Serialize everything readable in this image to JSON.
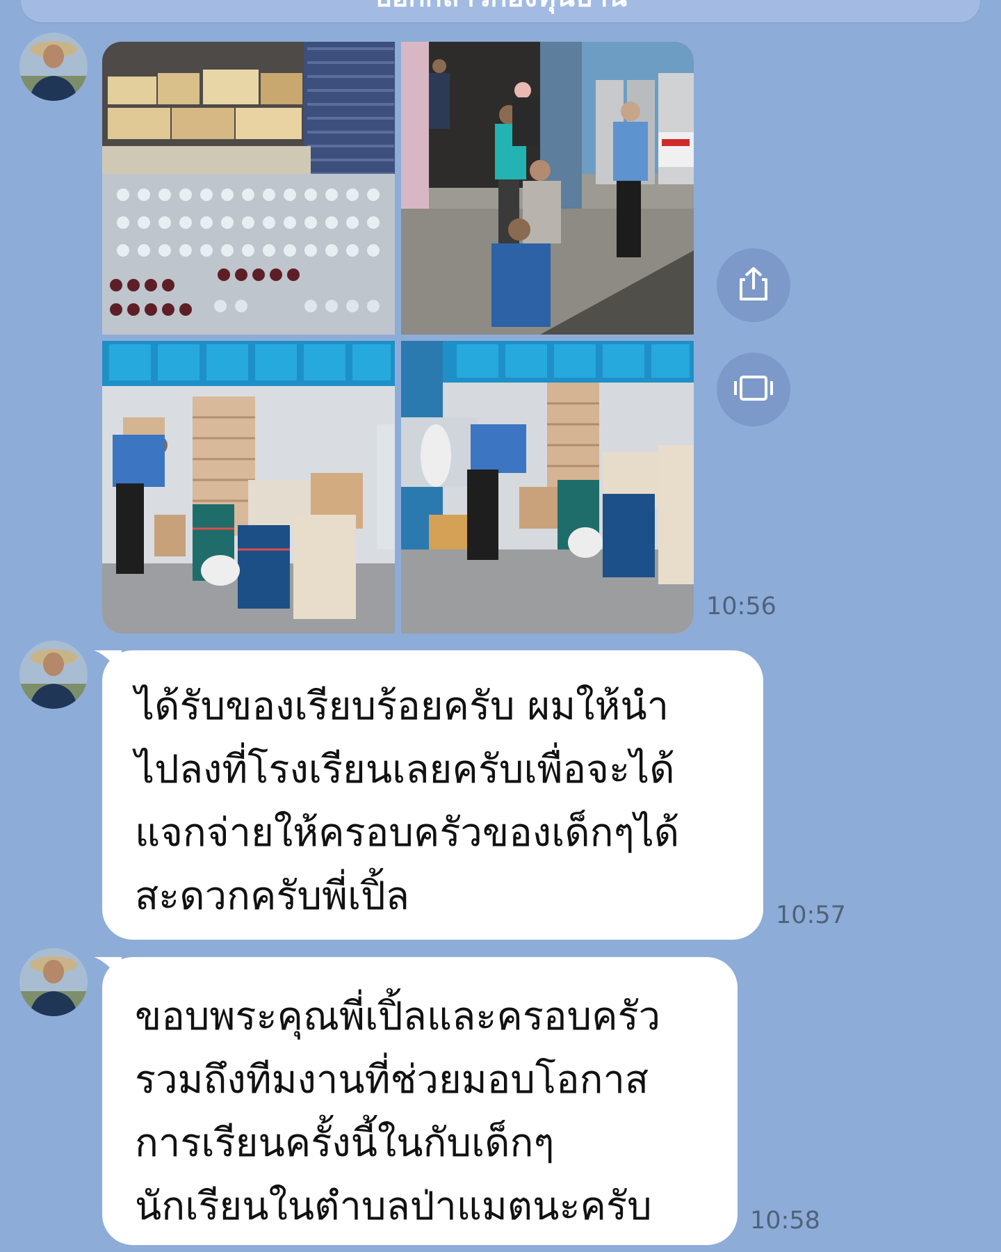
{
  "header": {
    "title": "บอกกล่าวกองทุนบ้าน"
  },
  "colors": {
    "chat_background": "#8eacd8",
    "bubble": "#ffffff",
    "header": "#a3bbe2",
    "action_button": "#7c99c9",
    "timestamp": "#4f6279"
  },
  "messages": [
    {
      "type": "photo-album",
      "photo_count": 4,
      "photos": [
        {
          "caption": "truck loaded with drinking water bottles and boxes"
        },
        {
          "caption": "men handing over bottled water at a building entrance"
        },
        {
          "caption": "donated supplies stacked against a wall, man writing"
        },
        {
          "caption": "donated supplies and woven bags against a wall"
        }
      ],
      "actions": [
        {
          "icon": "share-icon"
        },
        {
          "icon": "slideshow-icon"
        }
      ],
      "time": "10:56"
    },
    {
      "type": "text",
      "lines": [
        "ได้รับของเรียบร้อยครับ ผมให้นำ",
        "ไปลงที่โรงเรียนเลยครับเพื่อจะได้",
        "แจกจ่ายให้ครอบครัวของเด็กๆได้",
        "สะดวกครับพี่เปิ้ล"
      ],
      "time": "10:57"
    },
    {
      "type": "text",
      "lines": [
        "ขอบพระคุณพี่เปิ้ลและครอบครัว",
        "รวมถึงทีมงานที่ช่วยมอบโอกาส",
        "การเรียนครั้งนี้ในกับเด็กๆ",
        "นักเรียนในตำบลป่าแมตนะครับ"
      ],
      "time": "10:58"
    }
  ]
}
